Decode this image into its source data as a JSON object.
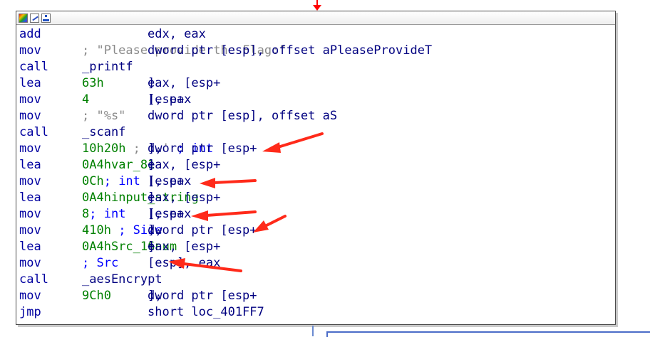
{
  "window": {
    "title_icons": [
      "color-palette-icon",
      "edit-node-icon",
      "graph-overview-icon"
    ]
  },
  "lines": [
    {
      "mnemonic": "add",
      "parts": [
        {
          "t": "edx, eax",
          "c": "op"
        }
      ]
    },
    {
      "mnemonic": "mov",
      "parts": [
        {
          "t": "dword ptr [esp], offset aPleaseProvideT ",
          "c": "op"
        },
        {
          "t": "; \"Please provide the Flag:\"",
          "c": "cmt"
        }
      ]
    },
    {
      "mnemonic": "call",
      "parts": [
        {
          "t": "_printf",
          "c": "name"
        }
      ]
    },
    {
      "mnemonic": "lea",
      "parts": [
        {
          "t": "eax, [esp+",
          "c": "op"
        },
        {
          "t": "63h",
          "c": "num"
        },
        {
          "t": "]",
          "c": "op"
        }
      ]
    },
    {
      "mnemonic": "mov",
      "parts": [
        {
          "t": "[esp+",
          "c": "op"
        },
        {
          "t": "4",
          "c": "num"
        },
        {
          "t": "], eax",
          "c": "op"
        }
      ]
    },
    {
      "mnemonic": "mov",
      "parts": [
        {
          "t": "dword ptr [esp], offset aS ",
          "c": "op"
        },
        {
          "t": "; \"%s\"",
          "c": "cmt"
        }
      ]
    },
    {
      "mnemonic": "call",
      "parts": [
        {
          "t": "_scanf",
          "c": "name"
        }
      ]
    },
    {
      "mnemonic": "mov",
      "parts": [
        {
          "t": "dword ptr [esp+",
          "c": "op"
        },
        {
          "t": "10h",
          "c": "num"
        },
        {
          "t": "], ",
          "c": "op"
        },
        {
          "t": "20h",
          "c": "num"
        },
        {
          "t": " ; ' ' ",
          "c": "cmt"
        },
        {
          "t": "; int",
          "c": "typ"
        }
      ]
    },
    {
      "mnemonic": "lea",
      "parts": [
        {
          "t": "eax, [esp+",
          "c": "op"
        },
        {
          "t": "0A4h",
          "c": "num"
        },
        {
          "t": "+",
          "c": "op"
        },
        {
          "t": "var_81",
          "c": "num"
        },
        {
          "t": "]",
          "c": "op"
        }
      ]
    },
    {
      "mnemonic": "mov",
      "parts": [
        {
          "t": "[esp+",
          "c": "op"
        },
        {
          "t": "0Ch",
          "c": "num"
        },
        {
          "t": "], eax   ",
          "c": "op"
        },
        {
          "t": "; int",
          "c": "typ"
        }
      ]
    },
    {
      "mnemonic": "lea",
      "parts": [
        {
          "t": "eax, [esp+",
          "c": "op"
        },
        {
          "t": "0A4h",
          "c": "num"
        },
        {
          "t": "+",
          "c": "op"
        },
        {
          "t": "input_string",
          "c": "num"
        },
        {
          "t": "]",
          "c": "op"
        }
      ]
    },
    {
      "mnemonic": "mov",
      "parts": [
        {
          "t": "[esp+",
          "c": "op"
        },
        {
          "t": "8",
          "c": "num"
        },
        {
          "t": "], eax    ",
          "c": "op"
        },
        {
          "t": "; int",
          "c": "typ"
        }
      ]
    },
    {
      "mnemonic": "mov",
      "parts": [
        {
          "t": "dword ptr [esp+",
          "c": "op"
        },
        {
          "t": "4",
          "c": "num"
        },
        {
          "t": "], ",
          "c": "op"
        },
        {
          "t": "10h",
          "c": "num"
        },
        {
          "t": " ; Size",
          "c": "typ"
        }
      ]
    },
    {
      "mnemonic": "lea",
      "parts": [
        {
          "t": "eax, [esp+",
          "c": "op"
        },
        {
          "t": "0A4h",
          "c": "num"
        },
        {
          "t": "+",
          "c": "op"
        },
        {
          "t": "Src_16num",
          "c": "num"
        },
        {
          "t": "]",
          "c": "op"
        }
      ]
    },
    {
      "mnemonic": "mov",
      "parts": [
        {
          "t": "[esp], eax      ",
          "c": "op"
        },
        {
          "t": "; Src",
          "c": "typ"
        }
      ]
    },
    {
      "mnemonic": "call",
      "parts": [
        {
          "t": "_aesEncrypt",
          "c": "name"
        }
      ]
    },
    {
      "mnemonic": "mov",
      "parts": [
        {
          "t": "dword ptr [esp+",
          "c": "op"
        },
        {
          "t": "9Ch",
          "c": "num"
        },
        {
          "t": "], ",
          "c": "op"
        },
        {
          "t": "0",
          "c": "num"
        }
      ]
    },
    {
      "mnemonic": "jmp",
      "parts": [
        {
          "t": "short loc_401FF7",
          "c": "op"
        }
      ]
    }
  ],
  "colors": {
    "mnemonic": "#0000a0",
    "operand": "#000080",
    "number": "#008000",
    "comment": "#8a8a8a",
    "type_comment": "#0000ff",
    "annotation_arrow": "#ff2a1a",
    "edge": "#4b6cc8"
  }
}
